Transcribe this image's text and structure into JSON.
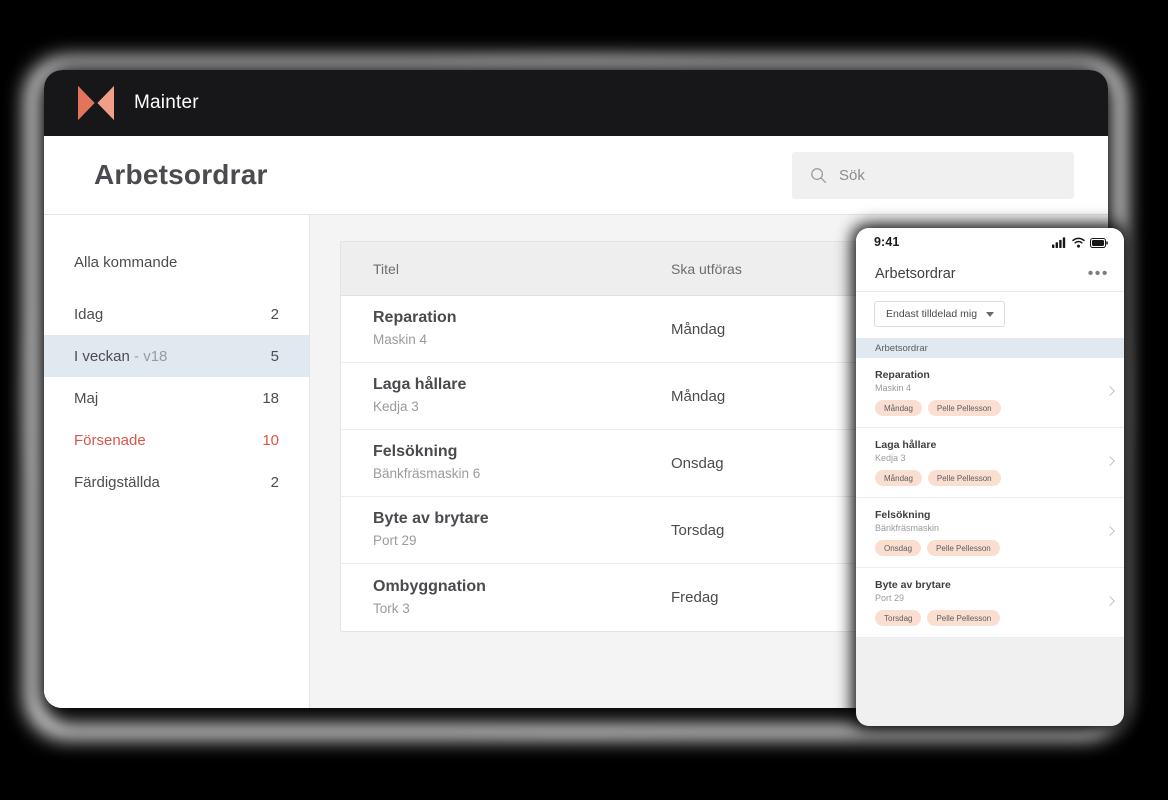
{
  "app": {
    "brand": "Mainter",
    "logo_color_left": "#e2735c",
    "logo_color_right": "#f0a08c",
    "topbar_bg": "#17171a"
  },
  "header": {
    "title": "Arbetsordrar",
    "search": {
      "placeholder": "Sök",
      "icon": "search-icon",
      "value": ""
    }
  },
  "sidebar": {
    "items": [
      {
        "label": "Alla kommande",
        "sub": "",
        "count": "",
        "selected": false,
        "overdue": false
      },
      {
        "label": "Idag",
        "sub": "",
        "count": "2",
        "selected": false,
        "overdue": false
      },
      {
        "label": "I veckan",
        "sub": " - v18",
        "count": "5",
        "selected": true,
        "overdue": false
      },
      {
        "label": "Maj",
        "sub": "",
        "count": "18",
        "selected": false,
        "overdue": false
      },
      {
        "label": "Försenade",
        "sub": "",
        "count": "10",
        "selected": false,
        "overdue": true
      },
      {
        "label": "Färdigställda",
        "sub": "",
        "count": "2",
        "selected": false,
        "overdue": false
      }
    ],
    "overdue_color": "#d6564c",
    "selected_bg": "#dfe9ef"
  },
  "table": {
    "columns": [
      "Titel",
      "Ska utföras"
    ],
    "rows": [
      {
        "title": "Reparation",
        "asset": "Maskin 4",
        "due": "Måndag"
      },
      {
        "title": "Laga hållare",
        "asset": "Kedja 3",
        "due": "Måndag"
      },
      {
        "title": "Felsökning",
        "asset": "Bänkfräsmaskin 6",
        "due": "Onsdag"
      },
      {
        "title": "Byte av brytare",
        "asset": "Port 29",
        "due": "Torsdag"
      },
      {
        "title": "Ombyggnation",
        "asset": "Tork 3",
        "due": "Fredag"
      }
    ]
  },
  "phone": {
    "status": {
      "time": "9:41",
      "signal_icon": "cellular-signal-icon",
      "wifi_icon": "wifi-icon",
      "battery_icon": "battery-icon"
    },
    "title": "Arbetsordrar",
    "more_icon": "more-options-icon",
    "filter": {
      "label": "Endast tilldelad mig",
      "caret_icon": "chevron-down-icon"
    },
    "section_title": "Arbetsordrar",
    "pill_bg": "#fadfd1",
    "items": [
      {
        "title": "Reparation",
        "asset": "Maskin 4",
        "day": "Måndag",
        "assignee": "Pelle Pellesson"
      },
      {
        "title": "Laga hållare",
        "asset": "Kedja 3",
        "day": "Måndag",
        "assignee": "Pelle Pellesson"
      },
      {
        "title": "Felsökning",
        "asset": "Bänkfräsmaskin",
        "day": "Onsdag",
        "assignee": "Pelle Pellesson"
      },
      {
        "title": "Byte av brytare",
        "asset": "Port 29",
        "day": "Torsdag",
        "assignee": "Pelle Pellesson"
      }
    ]
  }
}
